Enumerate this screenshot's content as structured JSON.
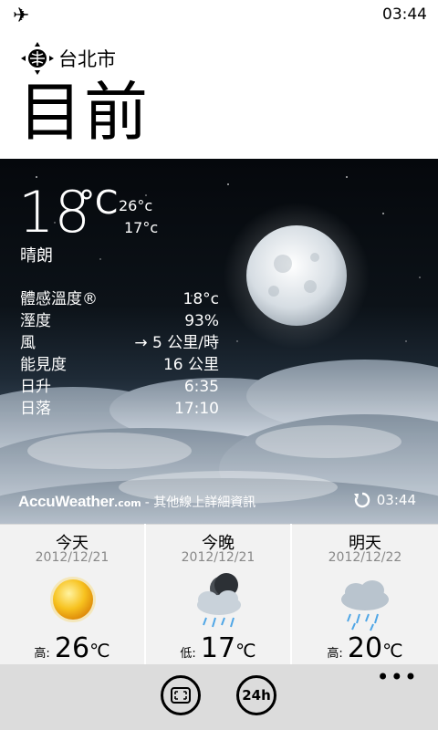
{
  "status": {
    "time": "03:44",
    "airplane_icon": "airplane-icon"
  },
  "location": {
    "city": "台北市",
    "icon": "location-crosshair-icon"
  },
  "page_title": "目前",
  "current": {
    "temp": "18",
    "unit": "°C",
    "high": "26°c",
    "low": "17°c",
    "condition": "晴朗",
    "details": [
      {
        "label": "體感溫度®",
        "value": "18°c"
      },
      {
        "label": "溼度",
        "value": "93%"
      },
      {
        "label": "風",
        "value": "→ 5 公里/時"
      },
      {
        "label": "能見度",
        "value": "16 公里"
      },
      {
        "label": "日升",
        "value": "6:35"
      },
      {
        "label": "日落",
        "value": "17:10"
      }
    ],
    "brand": "AccuWeather",
    "brand_suffix": ".com",
    "more_info": "- 其他線上詳細資訊",
    "updated": "03:44"
  },
  "forecast": [
    {
      "day": "今天",
      "date": "2012/12/21",
      "label": "高:",
      "temp": "26",
      "unit": "℃",
      "icon": "sunny-icon"
    },
    {
      "day": "今晚",
      "date": "2012/12/21",
      "label": "低:",
      "temp": "17",
      "unit": "℃",
      "icon": "night-rain-icon"
    },
    {
      "day": "明天",
      "date": "2012/12/22",
      "label": "高:",
      "temp": "20",
      "unit": "℃",
      "icon": "rain-cloud-icon"
    }
  ],
  "appbar": {
    "btn2_label": "24h",
    "more": "•••"
  },
  "colors": {
    "sun": "#f6b51c",
    "hero_top": "#05080c",
    "appbar": "#dcdcdc"
  }
}
